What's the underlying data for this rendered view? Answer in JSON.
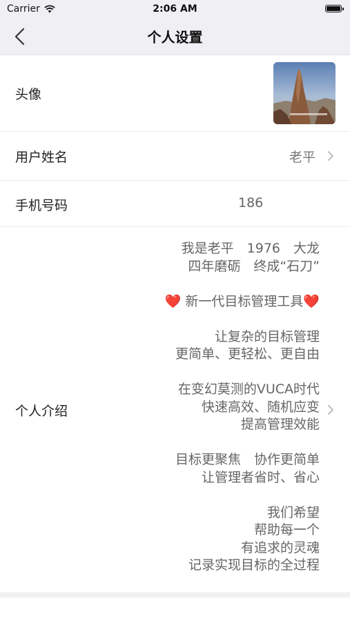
{
  "status_bar": {
    "carrier": "Carrier",
    "time": "2:06 AM"
  },
  "nav": {
    "title": "个人设置"
  },
  "rows": {
    "avatar": {
      "label": "头像"
    },
    "username": {
      "label": "用户姓名",
      "value": "老平"
    },
    "phone": {
      "label": "手机号码",
      "value": "186"
    },
    "intro": {
      "label": "个人介绍",
      "paragraphs": [
        [
          "我是老平　1976　大龙",
          "四年磨砺　终成“石刀”"
        ],
        [
          "❤️ 新一代目标管理工具❤️"
        ],
        [
          "让复杂的目标管理",
          "更简单、更轻松、更自由"
        ],
        [
          "在变幻莫测的VUCA时代",
          "快速高效、随机应变",
          "提高管理效能"
        ],
        [
          "目标更聚焦　协作更简单",
          "让管理者省时、省心"
        ],
        [
          "我们希望",
          "帮助每一个",
          "有追求的灵魂",
          "记录实现目标的全过程"
        ]
      ]
    }
  },
  "colors": {
    "nav_bg": "#efeff4",
    "heart": "#e0323d",
    "value_text": "#777777"
  }
}
